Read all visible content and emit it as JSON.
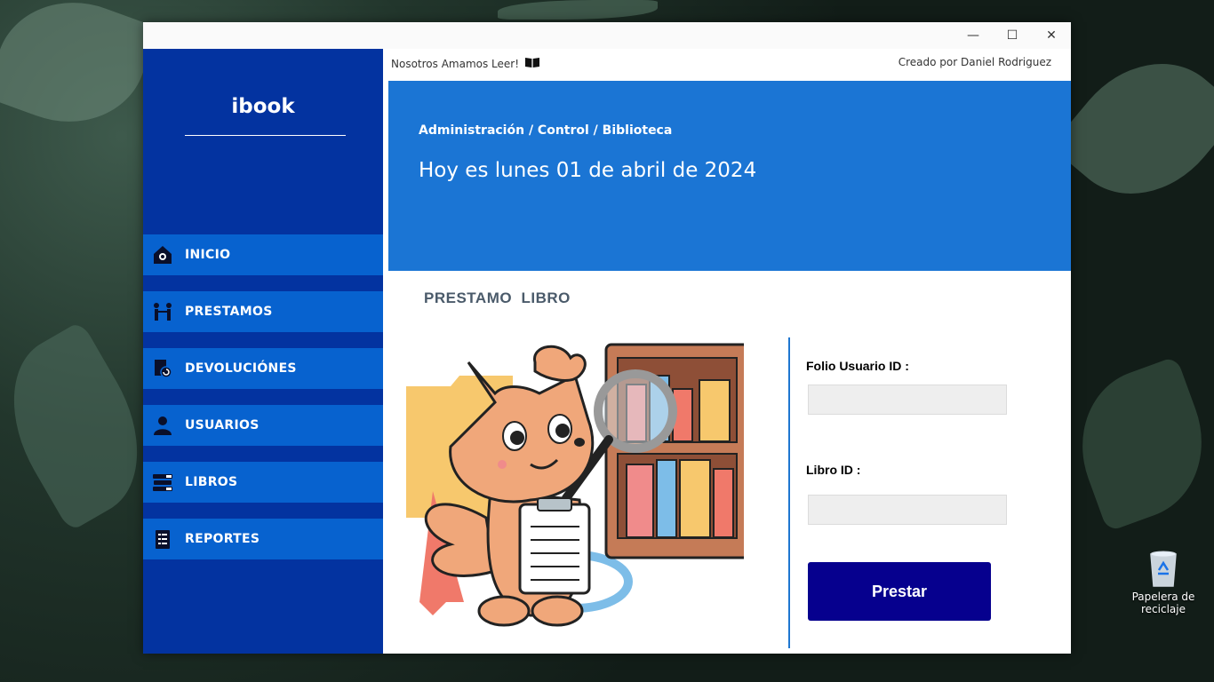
{
  "window": {
    "minimize_glyph": "—",
    "maximize_glyph": "☐",
    "close_glyph": "✕"
  },
  "sidebar": {
    "brand": "ibook",
    "items": [
      {
        "label": "INICIO",
        "icon": "home-icon"
      },
      {
        "label": "PRESTAMOS",
        "icon": "handshake-people-icon"
      },
      {
        "label": "DEVOLUCIÓNES",
        "icon": "return-book-icon"
      },
      {
        "label": "USUARIOS",
        "icon": "user-icon"
      },
      {
        "label": "LIBROS",
        "icon": "books-stack-icon"
      },
      {
        "label": "REPORTES",
        "icon": "clipboard-list-icon"
      }
    ]
  },
  "header": {
    "tagline": "Nosotros Amamos Leer!",
    "credit": "Creado por Daniel Rodriguez"
  },
  "banner": {
    "breadcrumb": "Administración / Control / Biblioteca",
    "today": "Hoy es lunes 01 de abril de 2024"
  },
  "form": {
    "section_title": "PRESTAMO  LIBRO",
    "folio_label": "Folio Usuario ID :",
    "folio_value": "",
    "libro_label": "Libro ID :",
    "libro_value": "",
    "submit_label": "Prestar"
  },
  "desktop": {
    "recycle_label": "Papelera de reciclaje"
  },
  "colors": {
    "sidebar": "#0333a0",
    "nav_item": "#0762cf",
    "banner": "#1b75d4",
    "button": "#06008e"
  }
}
